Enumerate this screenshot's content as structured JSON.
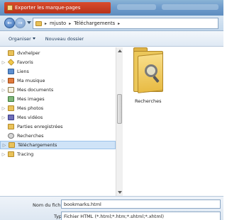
{
  "window": {
    "title": "Exporter les marque-pages"
  },
  "address": {
    "crumbs": [
      "mjusto",
      "Téléchargements"
    ]
  },
  "toolbar": {
    "organize_label": "Organiser",
    "new_folder_label": "Nouveau dossier"
  },
  "navigation": {
    "items": [
      {
        "label": "dvxhelper",
        "icon": "folder-icon",
        "expandable": false
      },
      {
        "label": "Favoris",
        "icon": "favorites-folder-icon",
        "expandable": true
      },
      {
        "label": "Liens",
        "icon": "links-folder-icon",
        "expandable": false
      },
      {
        "label": "Ma musique",
        "icon": "music-folder-icon",
        "expandable": true
      },
      {
        "label": "Mes documents",
        "icon": "documents-folder-icon",
        "expandable": true
      },
      {
        "label": "Mes images",
        "icon": "pictures-folder-icon",
        "expandable": false
      },
      {
        "label": "Mes photos",
        "icon": "folder-icon",
        "expandable": true
      },
      {
        "label": "Mes vidéos",
        "icon": "videos-folder-icon",
        "expandable": true
      },
      {
        "label": "Parties enregistrées",
        "icon": "saved-games-folder-icon",
        "expandable": false
      },
      {
        "label": "Recherches",
        "icon": "searches-folder-icon",
        "expandable": false
      },
      {
        "label": "Téléchargements",
        "icon": "downloads-folder-icon",
        "expandable": true,
        "selected": true
      },
      {
        "label": "Tracing",
        "icon": "folder-icon",
        "expandable": true
      }
    ]
  },
  "content": {
    "items": [
      {
        "label": "Recherches",
        "icon": "search-folder-icon"
      }
    ]
  },
  "filename": {
    "label": "Nom du fichier :",
    "value": "bookmarks.html"
  },
  "filetype": {
    "label": "Type :",
    "value": "Fichier HTML (*.html;*.htm;*.shtml;*.xhtml)"
  },
  "colors": {
    "selection": "#cfe3f7",
    "folder": "#e9c25a",
    "titlebar": "#6f9ccc"
  }
}
